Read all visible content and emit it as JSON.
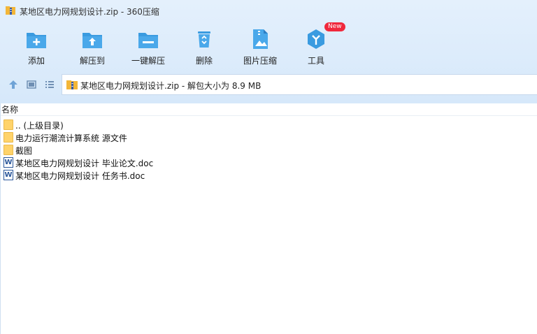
{
  "window": {
    "title": "某地区电力网规划设计.zip - 360压缩",
    "icon": "zip-archive-icon"
  },
  "toolbar": {
    "items": [
      {
        "label": "添加",
        "icon": "add-folder-icon"
      },
      {
        "label": "解压到",
        "icon": "extract-to-icon"
      },
      {
        "label": "一键解压",
        "icon": "one-click-extract-icon"
      },
      {
        "label": "删除",
        "icon": "recycle-bin-icon"
      },
      {
        "label": "图片压缩",
        "icon": "image-compress-icon"
      },
      {
        "label": "工具",
        "icon": "tools-icon",
        "badge": "New"
      }
    ]
  },
  "address": {
    "text": "某地区电力网规划设计.zip - 解包大小为 8.9 MB",
    "icon": "zip-archive-icon"
  },
  "file_list": {
    "column_name": "名称",
    "items": [
      {
        "name": ".. (上级目录)",
        "type": "folder"
      },
      {
        "name": "电力运行潮流计算系统 源文件",
        "type": "folder"
      },
      {
        "name": "截图",
        "type": "folder"
      },
      {
        "name": "某地区电力网规划设计 毕业论文.doc",
        "type": "word"
      },
      {
        "name": "某地区电力网规划设计 任务书.doc",
        "type": "word"
      }
    ]
  },
  "colors": {
    "accent": "#3a9be0",
    "toolbar_bg": "#dcebfb",
    "new_badge": "#f0283c"
  }
}
